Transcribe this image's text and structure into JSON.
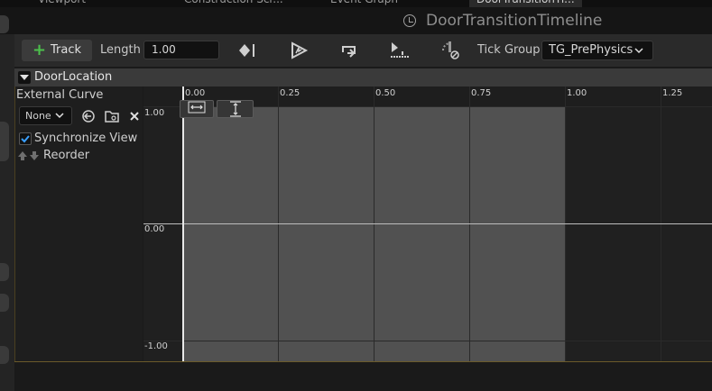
{
  "tabs": [
    {
      "label": "Viewport"
    },
    {
      "label": "Construction Scr..."
    },
    {
      "label": "Event Graph"
    },
    {
      "label": "DoorTransitionTi..."
    }
  ],
  "window_title": "DoorTransitionTimeline",
  "toolbar": {
    "track_label": "Track",
    "length_label": "Length",
    "length_value": "1.00",
    "tick_group_label": "Tick Group",
    "tick_group_value": "TG_PrePhysics"
  },
  "track": {
    "name": "DoorLocation",
    "external_curve_label": "External Curve",
    "curve_select_value": "None",
    "synchronize_view_label": "Synchronize View",
    "synchronize_view_checked": true,
    "reorder_label": "Reorder"
  },
  "graph": {
    "x_ticks": [
      "0.00",
      "0.25",
      "0.50",
      "0.75",
      "1.00",
      "1.25"
    ],
    "y_labels": [
      "1.00",
      "0.00",
      "-1.00"
    ]
  },
  "icons": {
    "add": "plus-icon",
    "keyframe": "keyframe-icon",
    "autoplay": "autoplay-icon",
    "loop": "loop-icon",
    "last_keyframe": "use-last-keyframe-icon",
    "replicated": "replicated-icon",
    "back_to_curve": "return-icon",
    "browse_folder": "folder-icon",
    "clear": "close-icon",
    "fit_horizontal": "fit-horizontal-icon",
    "fit_vertical": "fit-vertical-icon"
  },
  "colors": {
    "accent_green": "#4cc04c",
    "check_blue": "#3aa0ff",
    "timeline_active": "#515151"
  }
}
